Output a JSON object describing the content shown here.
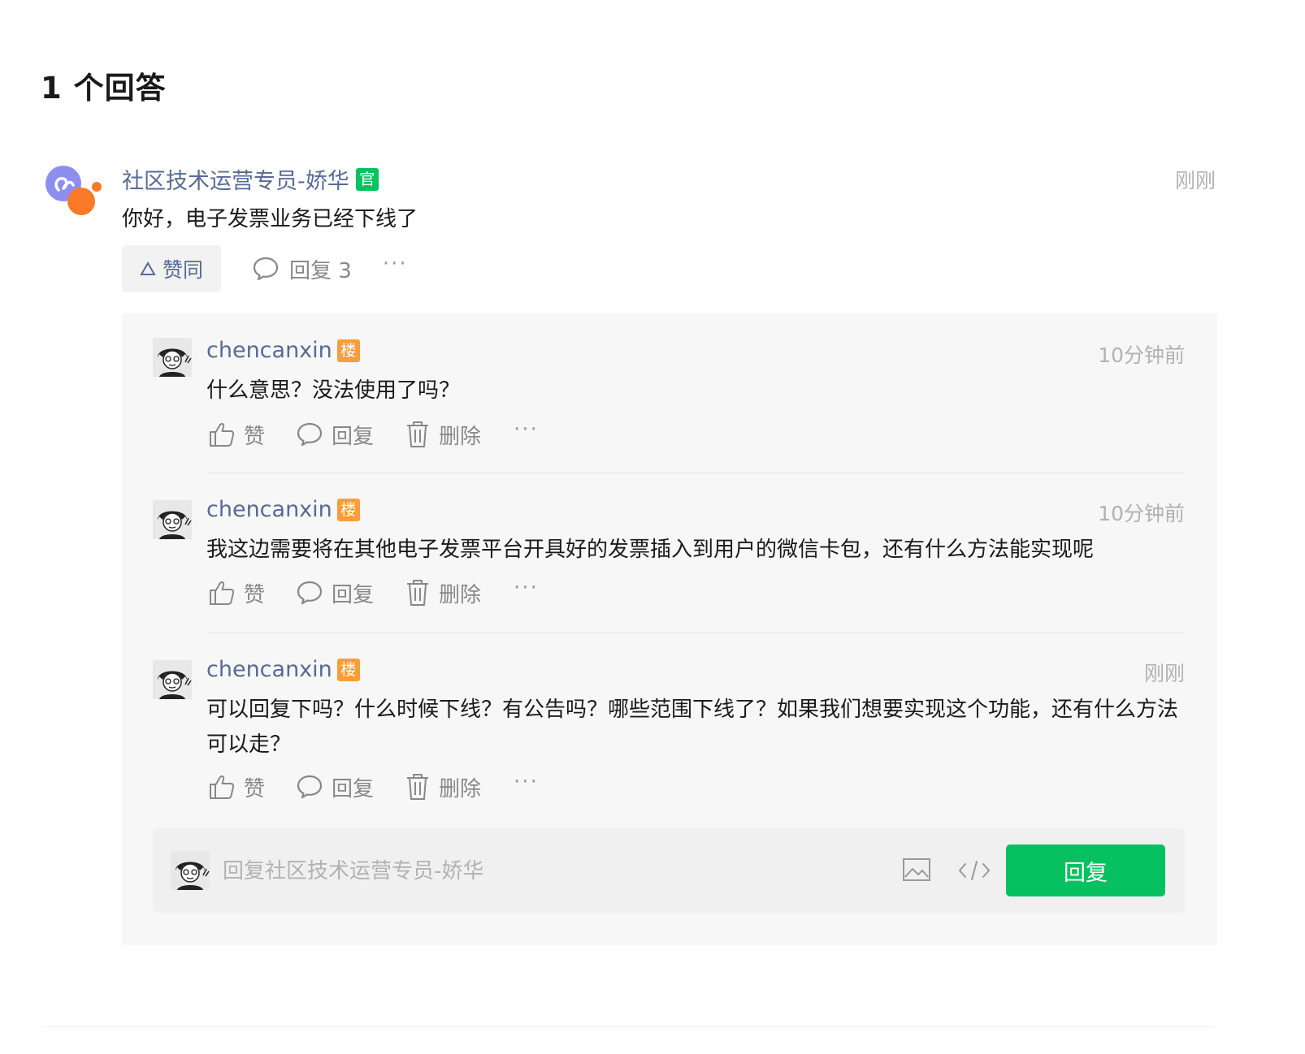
{
  "answers_title": "1 个回答",
  "answer": {
    "author": "社区技术运营专员-娇华",
    "official_badge": "官",
    "time": "刚刚",
    "content": "你好，电子发票业务已经下线了",
    "agree_label": "赞同",
    "reply_count_label": "回复 3",
    "more_label": "···"
  },
  "replies": [
    {
      "author": "chencanxin",
      "floor_badge": "楼",
      "time": "10分钟前",
      "content": "什么意思？没法使用了吗？",
      "like_label": "赞",
      "reply_label": "回复",
      "delete_label": "删除",
      "more_label": "···"
    },
    {
      "author": "chencanxin",
      "floor_badge": "楼",
      "time": "10分钟前",
      "content": "我这边需要将在其他电子发票平台开具好的发票插入到用户的微信卡包，还有什么方法能实现呢",
      "like_label": "赞",
      "reply_label": "回复",
      "delete_label": "删除",
      "more_label": "···"
    },
    {
      "author": "chencanxin",
      "floor_badge": "楼",
      "time": "刚刚",
      "content": "可以回复下吗？什么时候下线？有公告吗？哪些范围下线了？如果我们想要实现这个功能，还有什么方法可以走？",
      "like_label": "赞",
      "reply_label": "回复",
      "delete_label": "删除",
      "more_label": "···"
    }
  ],
  "composer": {
    "placeholder": "回复社区技术运营专员-娇华",
    "submit_label": "回复"
  },
  "colors": {
    "link_blue": "#576b95",
    "brand_green": "#07c160",
    "floor_orange": "#fa9d3b"
  }
}
